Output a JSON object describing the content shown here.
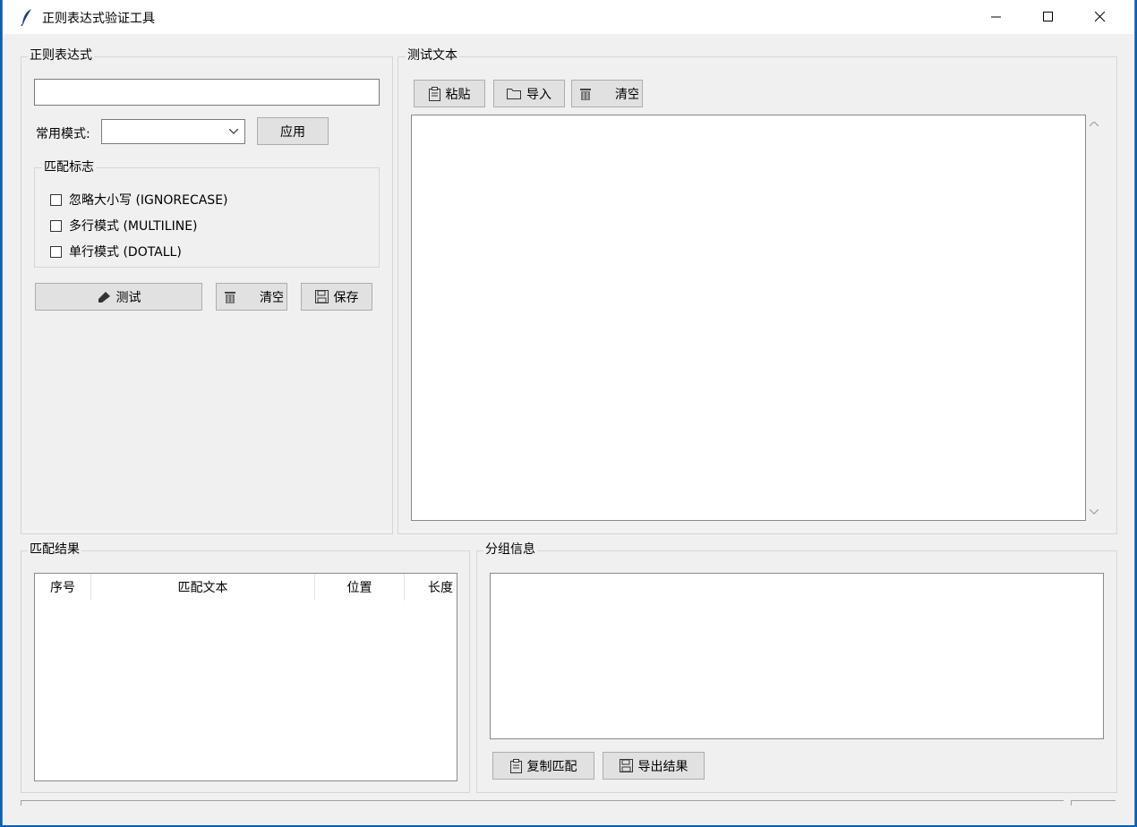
{
  "window": {
    "title": "正则表达式验证工具",
    "icon": "feather-icon"
  },
  "regex_group": {
    "legend": "正则表达式",
    "input_value": "",
    "common_patterns_label": "常用模式:",
    "common_patterns_selected": "",
    "apply_label": "应用",
    "flags": {
      "legend": "匹配标志",
      "items": [
        {
          "label": "忽略大小写 (IGNORECASE)",
          "checked": false
        },
        {
          "label": "多行模式 (MULTILINE)",
          "checked": false
        },
        {
          "label": "单行模式 (DOTALL)",
          "checked": false
        }
      ]
    },
    "buttons": {
      "test_label": "测试",
      "clear_label": "清空",
      "save_label": "保存"
    }
  },
  "test_text_group": {
    "legend": "测试文本",
    "buttons": {
      "paste_label": "粘贴",
      "import_label": "导入",
      "clear_label": "清空"
    },
    "text_value": ""
  },
  "results_group": {
    "legend": "匹配结果",
    "columns": [
      "序号",
      "匹配文本",
      "位置",
      "长度"
    ],
    "rows": []
  },
  "groups_group": {
    "legend": "分组信息",
    "text_value": "",
    "buttons": {
      "copy_label": "复制匹配",
      "export_label": "导出结果"
    }
  }
}
